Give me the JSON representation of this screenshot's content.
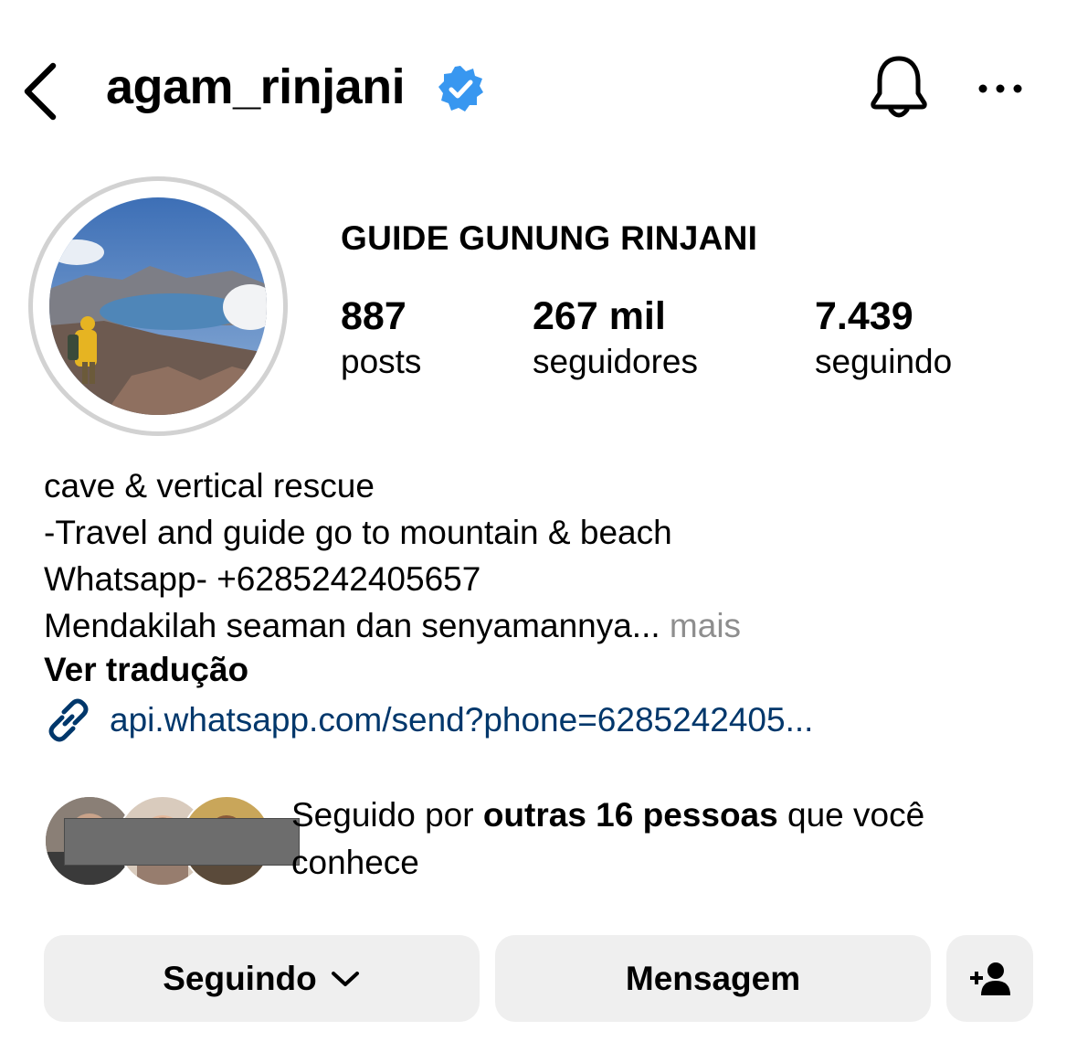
{
  "header": {
    "username": "agam_rinjani",
    "verified_color": "#3897f0"
  },
  "profile": {
    "display_name": "GUIDE GUNUNG RINJANI",
    "stats": [
      {
        "value": "887",
        "label": "posts"
      },
      {
        "value": "267 mil",
        "label": "seguidores"
      },
      {
        "value": "7.439",
        "label": "seguindo"
      }
    ]
  },
  "bio": {
    "lines": [
      "cave & vertical rescue",
      "-Travel and guide go to mountain & beach",
      "Whatsapp- +6285242405657",
      "Mendakilah seaman dan senyamannya..."
    ],
    "more": "mais",
    "translate": "Ver tradução",
    "link": "api.whatsapp.com/send?phone=6285242405..."
  },
  "followed_by": {
    "prefix": "Seguido por ",
    "bold": "outras 16 pessoas",
    "suffix": " que você conhece"
  },
  "actions": {
    "following": "Seguindo",
    "message": "Mensagem"
  },
  "icons": [
    "chevron-left-icon",
    "verified-badge-icon",
    "bell-icon",
    "more-icon",
    "link-icon",
    "chevron-down-icon",
    "add-person-icon"
  ],
  "colors": {
    "link": "#00376b",
    "button_bg": "#efefef",
    "muted": "#8e8e8e"
  }
}
